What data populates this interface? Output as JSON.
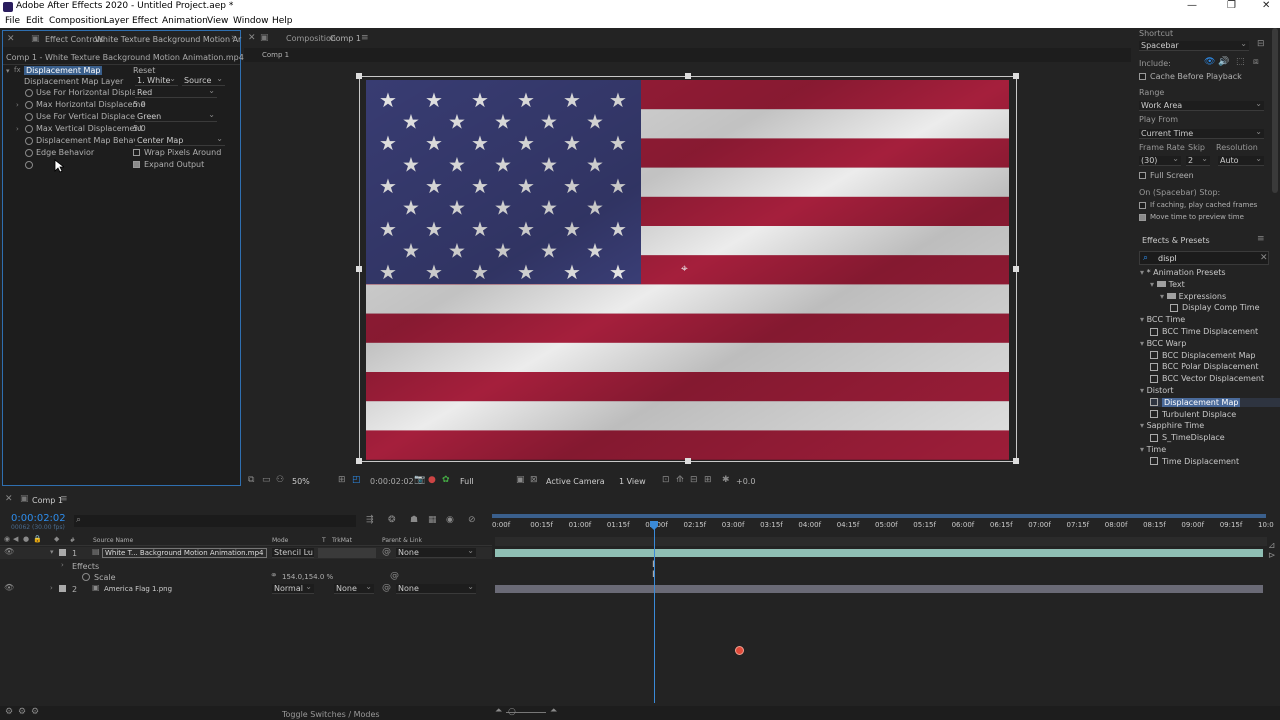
{
  "window": {
    "title": "Adobe After Effects 2020 - Untitled Project.aep *",
    "controls": [
      "—",
      "❐",
      "✕"
    ]
  },
  "menu": [
    "File",
    "Edit",
    "Composition",
    "Layer",
    "Effect",
    "Animation",
    "View",
    "Window",
    "Help"
  ],
  "effect_controls": {
    "tab_label": "Effect Controls",
    "tab_file": "White Texture Background Motion Ar",
    "breadcrumb": "Comp 1 - White Texture Background Motion Animation.mp4",
    "effect_name": "Displacement Map",
    "reset": "Reset",
    "props": [
      {
        "label": "Displacement Map Layer",
        "value": "1. White",
        "value2": "Source"
      },
      {
        "label": "Use For Horizontal Displace",
        "value": "Red"
      },
      {
        "label": "Max Horizontal Displaceme",
        "value": "5.0"
      },
      {
        "label": "Use For Vertical Displacem",
        "value": "Green"
      },
      {
        "label": "Max Vertical Displacement",
        "value": "5.0"
      },
      {
        "label": "Displacement Map Behavio",
        "value": "Center Map"
      },
      {
        "label": "Edge Behavior",
        "value": "Wrap Pixels Around"
      },
      {
        "label": "",
        "value": "Expand Output"
      }
    ]
  },
  "composition": {
    "tab_label": "Composition",
    "tab_name": "Comp 1",
    "sub_tab": "Comp 1",
    "footer": {
      "zoom": "50%",
      "timecode": "0:00:02:02",
      "resolution": "Full",
      "camera": "Active Camera",
      "view": "1 View",
      "exposure": "+0.0"
    }
  },
  "preview": {
    "shortcut_label": "Shortcut",
    "shortcut": "Spacebar",
    "include_label": "Include:",
    "cache": "Cache Before Playback",
    "range_label": "Range",
    "range": "Work Area",
    "play_from_label": "Play From",
    "play_from": "Current Time",
    "frame_rate_label": "Frame Rate",
    "frame_rate": "(30)",
    "skip_label": "Skip",
    "skip": "2",
    "resolution_label": "Resolution",
    "resolution": "Auto",
    "full_screen": "Full Screen",
    "on_stop_label": "On (Spacebar) Stop:",
    "if_caching": "If caching, play cached frames",
    "move_time": "Move time to preview time"
  },
  "effects_presets": {
    "title": "Effects & Presets",
    "search": "displ",
    "items": [
      {
        "type": "cat",
        "label": "* Animation Presets",
        "indent": 0
      },
      {
        "type": "folder",
        "label": "Text",
        "indent": 1
      },
      {
        "type": "folder",
        "label": "Expressions",
        "indent": 2
      },
      {
        "type": "preset",
        "label": "Display Comp Time",
        "indent": 3
      },
      {
        "type": "cat",
        "label": "BCC Time",
        "indent": 0
      },
      {
        "type": "preset",
        "label": "BCC Time Displacement",
        "indent": 1
      },
      {
        "type": "cat",
        "label": "BCC Warp",
        "indent": 0
      },
      {
        "type": "preset",
        "label": "BCC Displacement Map",
        "indent": 1
      },
      {
        "type": "preset",
        "label": "BCC Polar Displacement",
        "indent": 1
      },
      {
        "type": "preset",
        "label": "BCC Vector Displacement",
        "indent": 1
      },
      {
        "type": "cat",
        "label": "Distort",
        "indent": 0
      },
      {
        "type": "preset",
        "label": "Displacement Map",
        "indent": 1,
        "selected": true
      },
      {
        "type": "preset",
        "label": "Turbulent Displace",
        "indent": 1
      },
      {
        "type": "cat",
        "label": "Sapphire Time",
        "indent": 0
      },
      {
        "type": "preset",
        "label": "S_TimeDisplace",
        "indent": 1
      },
      {
        "type": "cat",
        "label": "Time",
        "indent": 0
      },
      {
        "type": "preset",
        "label": "Time Displacement",
        "indent": 1
      }
    ]
  },
  "timeline": {
    "tab": "Comp 1",
    "timecode": "0:00:02:02",
    "frames": "00062 (30.00 fps)",
    "cols": {
      "num": "#",
      "source": "Source Name",
      "mode": "Mode",
      "t": "T",
      "trkmat": "TrkMat",
      "parent": "Parent & Link"
    },
    "layers": [
      {
        "num": "1",
        "name": "White T... Background Motion Animation.mp4",
        "mode": "Stencil Lu",
        "trkmat": "",
        "parent": "None"
      },
      {
        "num": "2",
        "name": "America Flag 1.png",
        "mode": "Normal",
        "trkmat": "None",
        "parent": "None"
      }
    ],
    "effects_label": "Effects",
    "scale_label": "Scale",
    "scale_value": "154.0,154.0 %",
    "ticks": [
      "0:00f",
      "00:15f",
      "01:00f",
      "01:15f",
      "02:00f",
      "02:15f",
      "03:00f",
      "03:15f",
      "04:00f",
      "04:15f",
      "05:00f",
      "05:15f",
      "06:00f",
      "06:15f",
      "07:00f",
      "07:15f",
      "08:00f",
      "08:15f",
      "09:00f",
      "09:15f",
      "10:0"
    ],
    "toggle": "Toggle Switches / Modes"
  }
}
